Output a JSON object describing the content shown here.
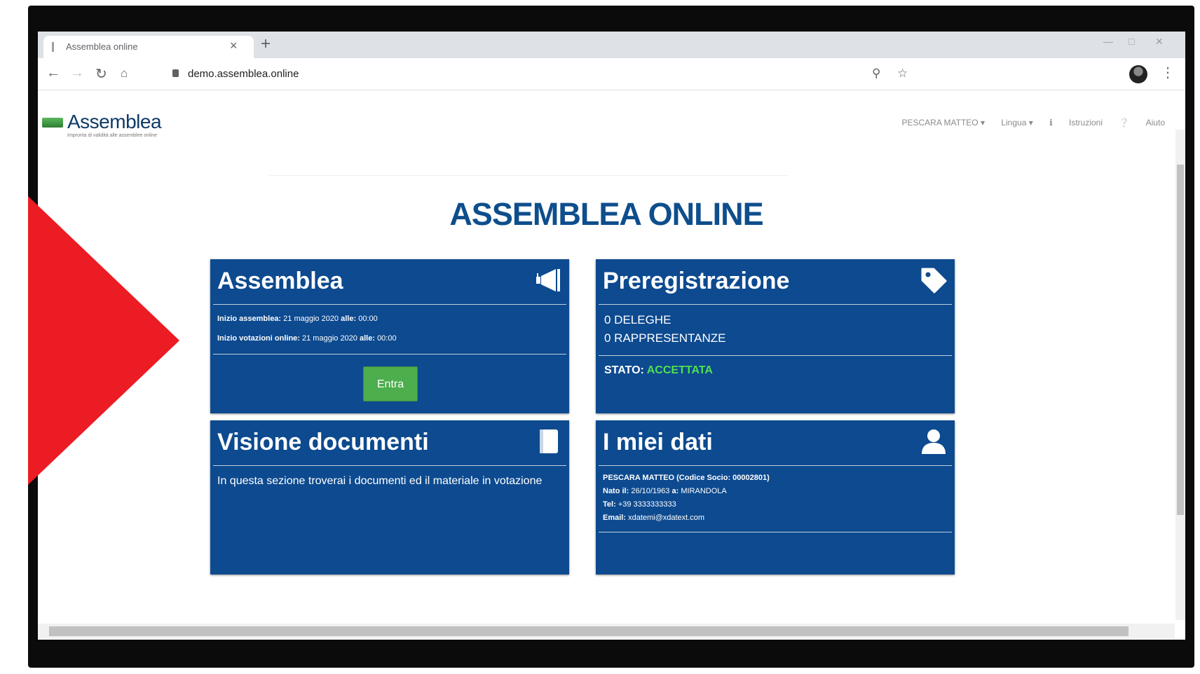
{
  "browser": {
    "tab_title": "Assemblea online",
    "tab_close": "×",
    "new_tab": "+",
    "url": "demo.assemblea.online",
    "colors": {
      "chrome": "#dee1e6"
    }
  },
  "header": {
    "logo_text": "Assemblea",
    "logo_tagline": "Impronta di validità alle assemblee online",
    "user_menu": "PESCARA MATTEO ▾",
    "language_menu": "Lingua ▾",
    "instructions": "Istruzioni",
    "help": "Aiuto"
  },
  "main": {
    "title": "ASSEMBLEA ONLINE",
    "cards": {
      "assemblea": {
        "title": "Assemblea",
        "row1_label": "Inizio assemblea:",
        "row1_date": "21 maggio 2020",
        "row1_alle": "alle:",
        "row1_time": "00:00",
        "row2_label": "Inizio votazioni online:",
        "row2_date": "21 maggio 2020",
        "row2_alle": "alle:",
        "row2_time": "00:00",
        "button": "Entra"
      },
      "preregistrazione": {
        "title": "Preregistrazione",
        "deleghe": "0 DELEGHE",
        "rappresentanze": "0 RAPPRESENTANZE",
        "stato_label": "STATO:",
        "stato_value": "ACCETTATA"
      },
      "documenti": {
        "title": "Visione documenti",
        "text": "In questa sezione troverai i documenti ed il materiale in votazione"
      },
      "dati": {
        "title": "I miei dati",
        "name_line": "PESCARA MATTEO (Codice Socio: 00002801)",
        "born_label": "Nato il:",
        "born_date": "26/10/1963",
        "born_at": "a:",
        "born_place": "MIRANDOLA",
        "tel_label": "Tel:",
        "tel_value": "+39 3333333333",
        "email_label": "Email:",
        "email_value": "xdatemi@xdatext.com"
      }
    }
  },
  "colors": {
    "card_bg": "#0d4a8f",
    "title_blue": "#0e4e8c",
    "enter_green": "#4cae4c",
    "status_green": "#4fe04f",
    "play_red": "#ec1c24"
  },
  "icons": {
    "assemblea": "megaphone-icon",
    "preregistrazione": "tag-icon",
    "documenti": "book-icon",
    "dati": "user-icon",
    "video_overlay": "play-arrow-icon"
  }
}
